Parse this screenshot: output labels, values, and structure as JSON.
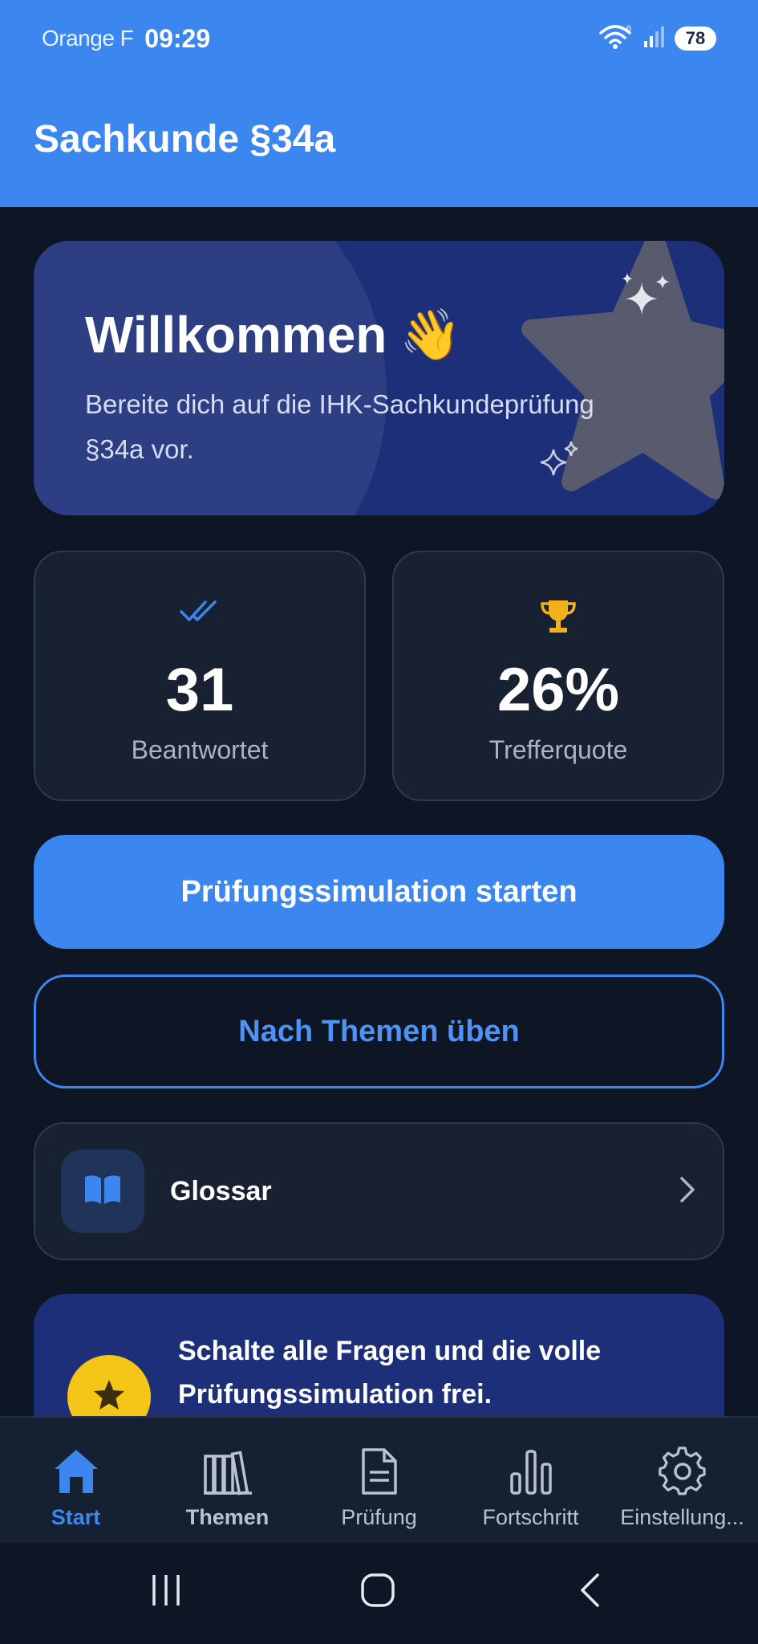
{
  "status_bar": {
    "carrier": "Orange F",
    "time": "09:29",
    "wifi_badge": "6",
    "battery": "78"
  },
  "app_bar": {
    "title": "Sachkunde §34a"
  },
  "hero": {
    "title": "Willkommen",
    "emoji": "👋",
    "subtitle": "Bereite dich auf die IHK-Sachkundeprüfung §34a vor."
  },
  "stats": [
    {
      "icon": "double-check-icon",
      "value": "31",
      "label": "Beantwortet"
    },
    {
      "icon": "trophy-icon",
      "value": "26%",
      "label": "Trefferquote"
    }
  ],
  "actions": {
    "primary_label": "Prüfungssimulation starten",
    "secondary_label": "Nach Themen üben"
  },
  "glossary": {
    "label": "Glossar",
    "icon": "book-icon"
  },
  "promo": {
    "text": "Schalte alle Fragen und die volle Prüfungssimulation frei.",
    "icon": "star-icon"
  },
  "bottom_nav": [
    {
      "label": "Start",
      "icon": "home-icon",
      "active": true
    },
    {
      "label": "Themen",
      "icon": "books-icon",
      "active": false
    },
    {
      "label": "Prüfung",
      "icon": "document-icon",
      "active": false
    },
    {
      "label": "Fortschritt",
      "icon": "bar-chart-icon",
      "active": false
    },
    {
      "label": "Einstellung...",
      "icon": "gear-icon",
      "active": false
    }
  ],
  "colors": {
    "primary": "#3b86ef",
    "background": "#0e1524",
    "card": "#172132",
    "hero": "#1c2f78",
    "gold": "#f5c518"
  }
}
